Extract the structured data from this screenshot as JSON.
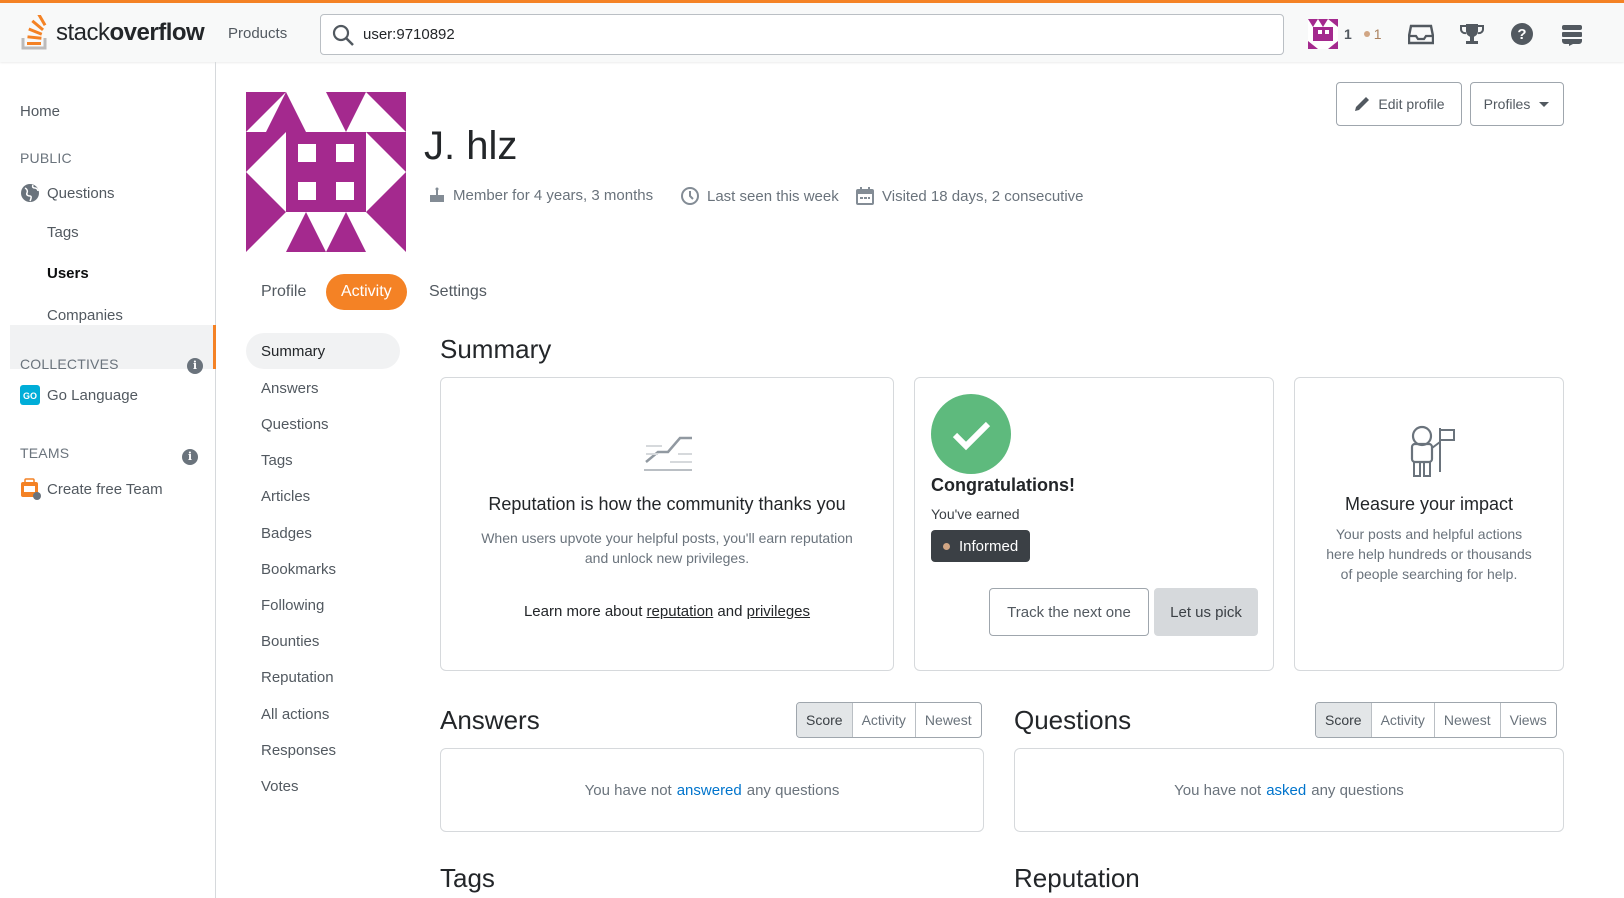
{
  "topbar": {
    "logo_text_light": "stack",
    "logo_text_bold": "overflow",
    "products_label": "Products",
    "search_value": "user:9710892",
    "reputation": "1",
    "bronze_badges": "1",
    "accent_color": "#f48225"
  },
  "sidebar": {
    "home": "Home",
    "public_heading": "PUBLIC",
    "questions": "Questions",
    "tags": "Tags",
    "users": "Users",
    "companies": "Companies",
    "collectives_heading": "COLLECTIVES",
    "go_language": "Go Language",
    "teams_heading": "TEAMS",
    "create_team": "Create free Team",
    "info_glyph": "i"
  },
  "profile": {
    "name": "J. hlz",
    "member_for": "Member for 4 years, 3 months",
    "last_seen": "Last seen this week",
    "visited": "Visited 18 days, 2 consecutive",
    "edit_profile": "Edit profile",
    "profiles": "Profiles",
    "avatar_color": "#a4298e"
  },
  "tabs": [
    {
      "label": "Profile",
      "active": false
    },
    {
      "label": "Activity",
      "active": true
    },
    {
      "label": "Settings",
      "active": false
    }
  ],
  "subnav": [
    "Summary",
    "Answers",
    "Questions",
    "Tags",
    "Articles",
    "Badges",
    "Bookmarks",
    "Following",
    "Bounties",
    "Reputation",
    "All actions",
    "Responses",
    "Votes"
  ],
  "summary": {
    "heading": "Summary",
    "rep_card": {
      "title": "Reputation is how the community thanks you",
      "text1": "When users upvote your helpful posts, you'll earn reputation",
      "text2": "and unlock new privileges.",
      "learn_prefix": "Learn more about ",
      "learn_link1": "reputation",
      "learn_and": " and ",
      "learn_link2": "privileges"
    },
    "badge_card": {
      "title": "Congratulations!",
      "earned": "You've earned",
      "badge": "Informed",
      "track_button": "Track the next one",
      "pick_button": "Let us pick"
    },
    "impact_card": {
      "title": "Measure your impact",
      "text1": "Your posts and helpful actions",
      "text2": "here help hundreds or thousands",
      "text3": "of people searching for help."
    }
  },
  "answers": {
    "heading": "Answers",
    "sort": [
      "Score",
      "Activity",
      "Newest"
    ],
    "empty_prefix": "You have not ",
    "empty_link": "answered",
    "empty_suffix": " any questions"
  },
  "questions": {
    "heading": "Questions",
    "sort": [
      "Score",
      "Activity",
      "Newest",
      "Views"
    ],
    "empty_prefix": "You have not ",
    "empty_link": "asked",
    "empty_suffix": " any questions"
  },
  "tags_heading": "Tags",
  "reputation_heading": "Reputation"
}
